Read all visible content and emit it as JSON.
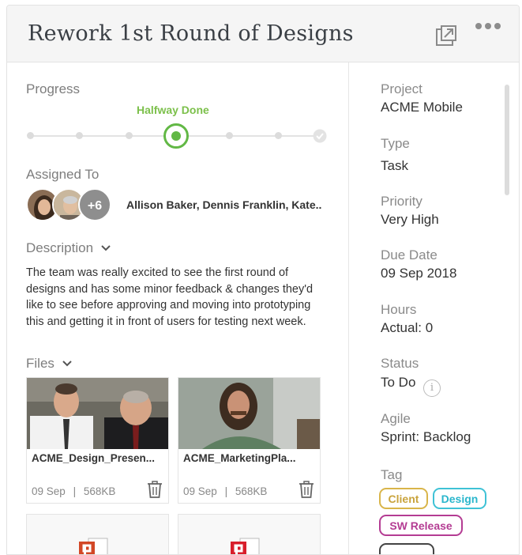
{
  "header": {
    "title": "Rework 1st Round of Designs",
    "popout_icon": "popout-icon",
    "more_icon": "more-horizontal-icon"
  },
  "progress": {
    "label": "Progress",
    "status_label": "Halfway Done",
    "steps_total": 7,
    "current_step": 4,
    "accent_color": "#62b845"
  },
  "assigned": {
    "label": "Assigned To",
    "extra_count": "+6",
    "names": "Allison Baker, Dennis Franklin, Kate.."
  },
  "description": {
    "label": "Description",
    "text": "The team was really excited to see the first round of designs and has some minor feedback & changes they'd like to see before approving and moving into prototyping this and getting it in front of users for testing next week."
  },
  "files": {
    "label": "Files",
    "items": [
      {
        "name": "ACME_Design_Presen...",
        "date": "09 Sep",
        "size": "568KB"
      },
      {
        "name": "ACME_MarketingPla...",
        "date": "09 Sep",
        "size": "568KB"
      }
    ],
    "separator": "|"
  },
  "details": {
    "project": {
      "label": "Project",
      "value": "ACME Mobile"
    },
    "type": {
      "label": "Type",
      "value": "Task"
    },
    "priority": {
      "label": "Priority",
      "value": "Very High"
    },
    "due_date": {
      "label": "Due Date",
      "value": "09 Sep 2018"
    },
    "hours": {
      "label": "Hours",
      "value": "Actual: 0"
    },
    "status": {
      "label": "Status",
      "value": "To Do"
    },
    "agile": {
      "label": "Agile",
      "value": "Sprint: Backlog"
    },
    "tag": {
      "label": "Tag"
    }
  },
  "tags": [
    {
      "label": "Client",
      "color": "#d9b54a"
    },
    {
      "label": "Design",
      "color": "#3fc2d6"
    },
    {
      "label": "SW Release",
      "color": "#b43c93"
    }
  ]
}
